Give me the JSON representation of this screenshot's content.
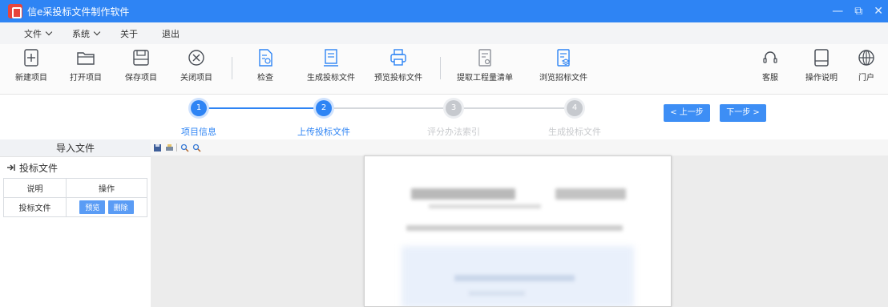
{
  "window": {
    "title": "信e采投标文件制作软件",
    "controls": [
      "—",
      "⧉",
      "✕"
    ]
  },
  "menu": [
    {
      "label": "文件",
      "has_dropdown": true
    },
    {
      "label": "系统",
      "has_dropdown": true
    },
    {
      "label": "关于",
      "has_dropdown": false
    },
    {
      "label": "退出",
      "has_dropdown": false
    }
  ],
  "toolbar": {
    "new_project": "新建项目",
    "open_project": "打开项目",
    "save_project": "保存项目",
    "close_project": "关闭项目",
    "check": "检查",
    "generate_bid": "生成投标文件",
    "preview_bid": "预览投标文件",
    "extract_quantities": "提取工程量清单",
    "browse_tender": "浏览招标文件",
    "customer_service": "客服",
    "manual": "操作说明",
    "portal": "门户"
  },
  "steps": [
    {
      "number": "1",
      "label": "项目信息",
      "state": "done"
    },
    {
      "number": "2",
      "label": "上传投标文件",
      "state": "current"
    },
    {
      "number": "3",
      "label": "评分办法索引",
      "state": "todo"
    },
    {
      "number": "4",
      "label": "生成投标文件",
      "state": "todo"
    }
  ],
  "nav": {
    "prev": "< 上一步",
    "next": "下一步 >"
  },
  "left_panel": {
    "header": "导入文件",
    "section": "投标文件",
    "table": {
      "columns": [
        "说明",
        "操作"
      ],
      "rows": [
        {
          "desc": "投标文件",
          "actions": [
            "预览",
            "删除"
          ]
        }
      ]
    }
  },
  "colors": {
    "titlebar": "#2e84f4",
    "accent": "#2e84f4",
    "inactive": "#c6c9ce",
    "button": "#3d8ef5"
  }
}
